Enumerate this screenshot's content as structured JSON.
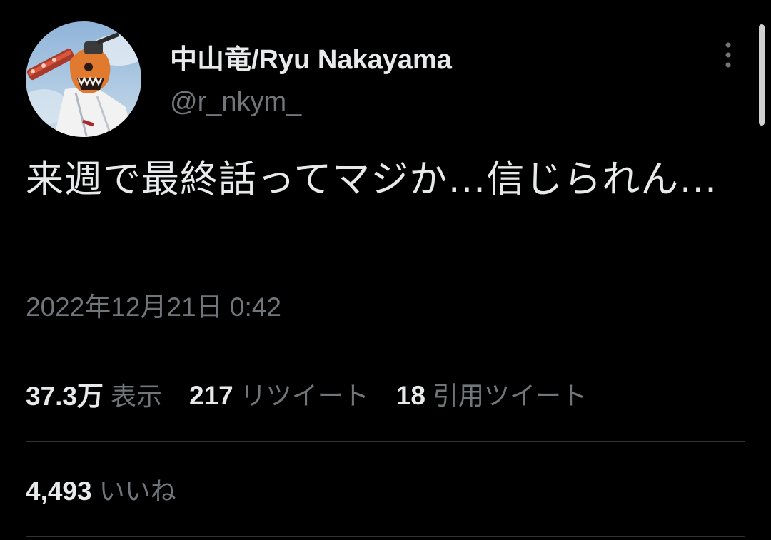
{
  "author": {
    "display_name": "中山竜/Ryu Nakayama",
    "handle": "@r_nkym_",
    "avatar_icon": "chainsaw-man-avatar"
  },
  "tweet": {
    "text": "来週で最終話ってマジか…信じられん…",
    "timestamp": "2022年12月21日 0:42"
  },
  "stats": {
    "views_value": "37.3万",
    "views_label": "表示",
    "retweets_value": "217",
    "retweets_label": "リツイート",
    "quotes_value": "18",
    "quotes_label": "引用ツイート"
  },
  "likes": {
    "value": "4,493",
    "label": "いいね"
  },
  "icons": {
    "more": "more-vertical-icon"
  },
  "colors": {
    "background": "#000000",
    "primary_text": "#e7e9ea",
    "secondary_text": "#71767b",
    "divider": "#2f3336"
  }
}
